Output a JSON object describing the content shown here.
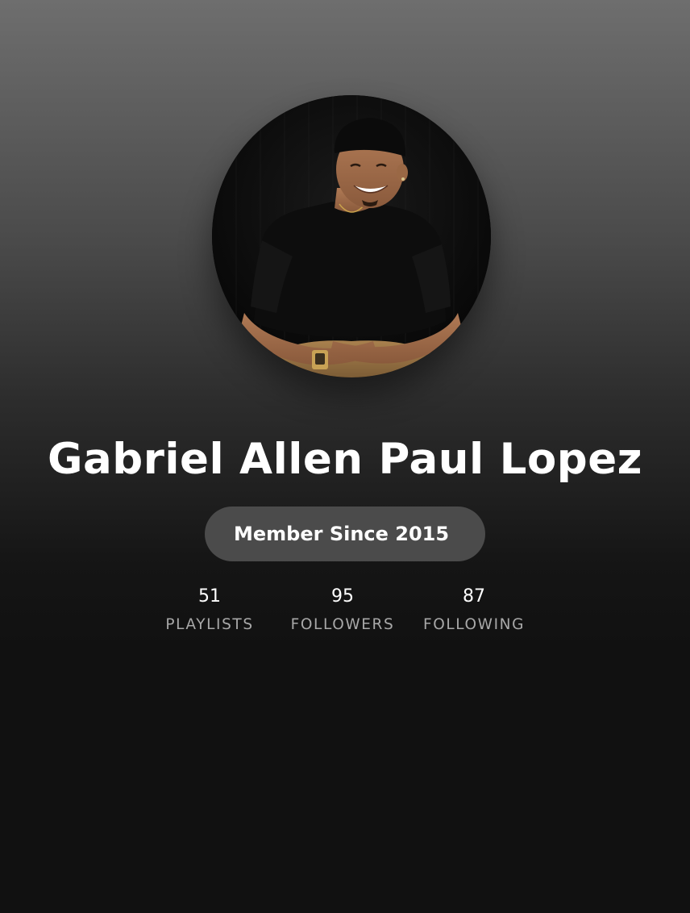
{
  "profile": {
    "name": "Gabriel Allen Paul Lopez",
    "member_since": "Member Since 2015",
    "avatar": "profile-photo"
  },
  "stats": [
    {
      "value": "51",
      "label": "PLAYLISTS"
    },
    {
      "value": "95",
      "label": "FOLLOWERS"
    },
    {
      "value": "87",
      "label": "FOLLOWING"
    }
  ],
  "colors": {
    "background_top": "#6e6e6e",
    "background_bottom": "#111111",
    "badge": "#4b4b4b",
    "label": "#a8a8a8",
    "text": "#ffffff"
  }
}
